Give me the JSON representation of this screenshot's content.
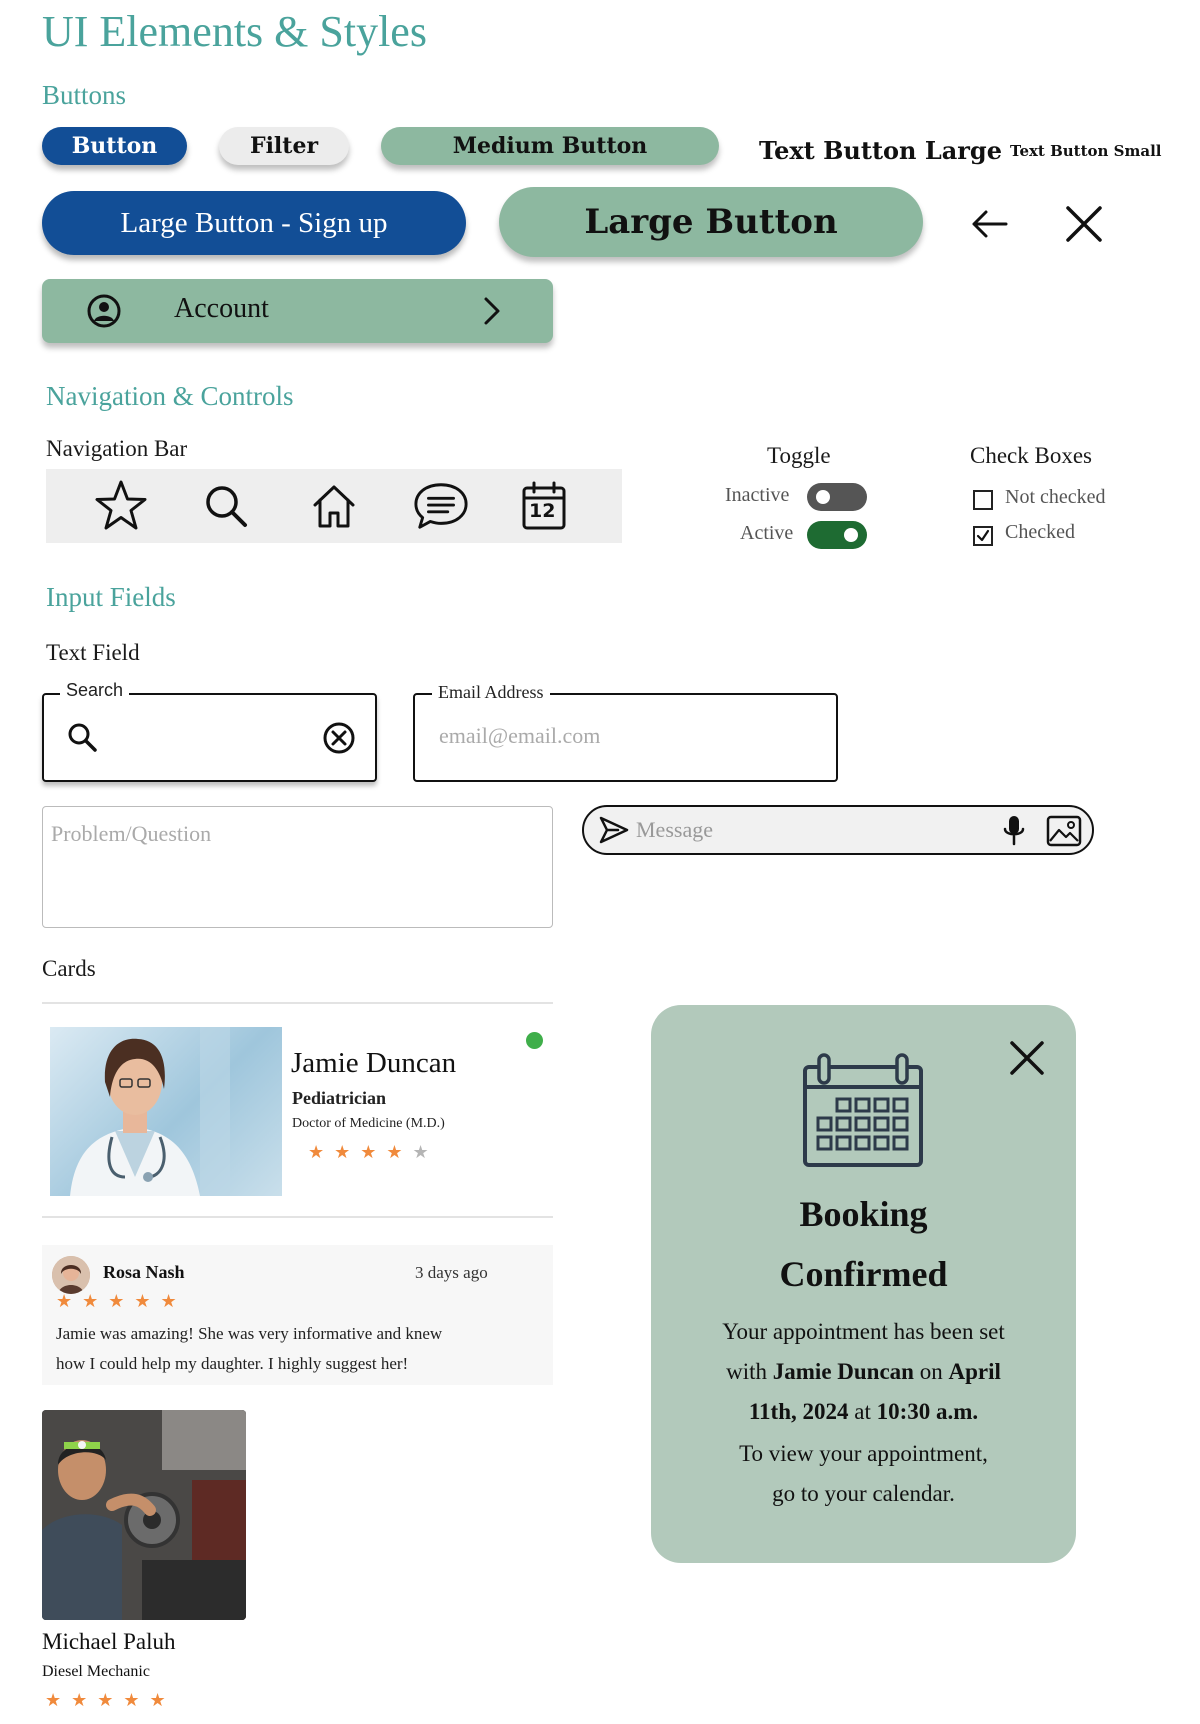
{
  "page": {
    "title": "UI Elements & Styles"
  },
  "buttons_section": {
    "title": "Buttons",
    "button": "Button",
    "filter": "Filter",
    "medium": "Medium Button",
    "text_large": "Text Button Large",
    "text_small": "Text Button Small",
    "large_signup": "Large Button - Sign up",
    "large": "Large Button",
    "account": "Account"
  },
  "navigation_section": {
    "title": "Navigation & Controls",
    "nav_bar_label": "Navigation Bar",
    "nav_items": [
      "star-icon",
      "search-icon",
      "home-icon",
      "chat-icon",
      "calendar-icon"
    ],
    "calendar_day": "12",
    "toggle": {
      "title": "Toggle",
      "inactive": "Inactive",
      "active": "Active"
    },
    "checkboxes": {
      "title": "Check Boxes",
      "unchecked": "Not checked",
      "checked": "Checked"
    }
  },
  "input_section": {
    "title": "Input Fields",
    "text_field_label": "Text Field",
    "search_legend": "Search",
    "email_legend": "Email Address",
    "email_placeholder": "email@email.com",
    "problem_placeholder": "Problem/Question",
    "message_placeholder": "Message"
  },
  "cards_section": {
    "title": "Cards",
    "doctor": {
      "name": "Jamie Duncan",
      "specialty": "Pediatrician",
      "degree": "Doctor of Medicine (M.D.)",
      "rating": 4,
      "online": true
    },
    "review": {
      "author": "Rosa Nash",
      "time": "3 days ago",
      "rating": 5,
      "text_line1": "Jamie was amazing! She was very informative and knew",
      "text_line2": "how I could help my daughter. I highly suggest her!"
    },
    "mechanic": {
      "name": "Michael Paluh",
      "role": "Diesel Mechanic",
      "rating": 5
    }
  },
  "booking": {
    "title_line1": "Booking",
    "title_line2": "Confirmed",
    "line1": "Your appointment has been set",
    "line2_pre": "with ",
    "line2_name": "Jamie Duncan",
    "line2_mid": " on ",
    "line2_date": "April",
    "line3_date": "11th, 2024",
    "line3_mid": " at ",
    "line3_time": "10:30 a.m.",
    "line4": "To view your appointment,",
    "line5": "go to your calendar."
  },
  "colors": {
    "teal_title": "#4aa39c",
    "primary_blue": "#124e96",
    "sage_green": "#8db8a0",
    "card_green": "#b2c9bb",
    "toggle_active": "#1e6b32",
    "toggle_inactive": "#555555",
    "star_orange": "#f08a3c",
    "online_dot": "#3fae4a"
  }
}
